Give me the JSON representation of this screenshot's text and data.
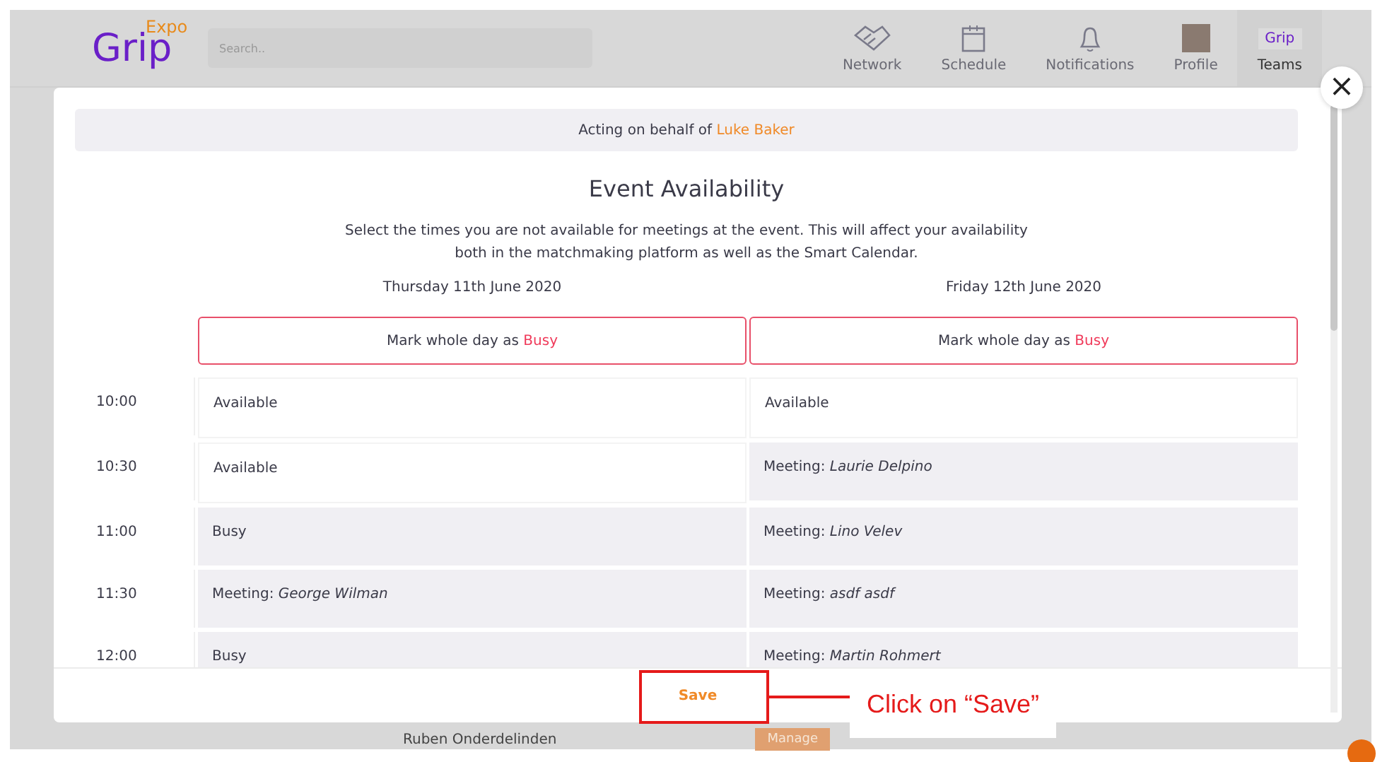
{
  "header": {
    "logo": {
      "main": "Grip",
      "sup": "Expo"
    },
    "search": {
      "placeholder": "Search.."
    },
    "nav": [
      {
        "label": "Network",
        "kind": "handshake",
        "selected": false
      },
      {
        "label": "Schedule",
        "kind": "calendar",
        "selected": false
      },
      {
        "label": "Notifications",
        "kind": "bell",
        "selected": false
      },
      {
        "label": "Profile",
        "kind": "avatar",
        "selected": false
      },
      {
        "label": "Teams",
        "kind": "logo",
        "logo_text": "Grip",
        "selected": true
      }
    ]
  },
  "background": {
    "member": "Ruben Onderdelinden",
    "button": "Manage"
  },
  "modal": {
    "banner": "Acting on behalf of ",
    "banner_name": "Luke Baker",
    "title": "Event Availability",
    "description": "Select the times you are not available for meetings at the event. This will affect your availability\nboth in the matchmaking platform as well as the Smart Calendar.",
    "days": [
      {
        "heading": "Thursday 11th June 2020",
        "mark_label": "Mark whole day as ",
        "mark_state": "Busy"
      },
      {
        "heading": "Friday 12th June 2020",
        "mark_label": "Mark whole day as ",
        "mark_state": "Busy"
      }
    ],
    "rows": [
      {
        "time": "10:00",
        "cells": [
          {
            "kind": "available",
            "text": "Available"
          },
          {
            "kind": "available",
            "text": "Available"
          }
        ]
      },
      {
        "time": "10:30",
        "cells": [
          {
            "kind": "available",
            "text": "Available"
          },
          {
            "kind": "meeting",
            "text": "Meeting: *Laurie Delpino*"
          }
        ]
      },
      {
        "time": "11:00",
        "cells": [
          {
            "kind": "busy",
            "text": "Busy"
          },
          {
            "kind": "meeting",
            "text": "Meeting: *Lino Velev*"
          }
        ]
      },
      {
        "time": "11:30",
        "cells": [
          {
            "kind": "meeting",
            "text": "Meeting: *George Wilman*"
          },
          {
            "kind": "meeting",
            "text": "Meeting: *asdf asdf*"
          }
        ]
      },
      {
        "time": "12:00",
        "cells": [
          {
            "kind": "busy",
            "text": "Busy"
          },
          {
            "kind": "meeting",
            "text": "Meeting: *Martin Rohmert*"
          }
        ]
      }
    ],
    "save": "Save",
    "close": "×"
  },
  "annotation": {
    "text": "Click on “Save”"
  }
}
